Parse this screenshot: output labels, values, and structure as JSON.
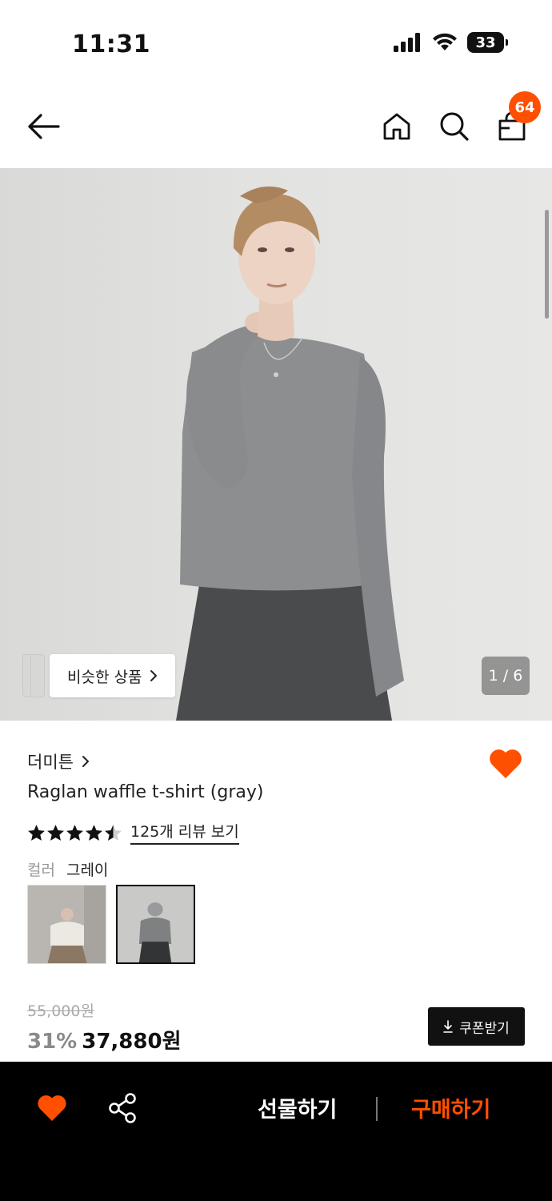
{
  "status_bar": {
    "time": "11:31",
    "battery": "33"
  },
  "header": {
    "cart_count": "64"
  },
  "hero": {
    "similar_button_label": "비슷한 상품",
    "page_counter": "1 / 6"
  },
  "product": {
    "brand": "더미튼",
    "name": "Raglan waffle t-shirt (gray)",
    "rating_stars": 4.5,
    "review_link": "125개 리뷰 보기",
    "color_label": "컬러",
    "color_value": "그레이",
    "original_price": "55,000원",
    "discount": "31%",
    "sale_price": "37,880원",
    "coupon_label": "쿠폰받기"
  },
  "bottom_bar": {
    "gift_label": "선물하기",
    "buy_label": "구매하기"
  },
  "colors": {
    "accent": "#ff4f00",
    "black": "#000000"
  }
}
